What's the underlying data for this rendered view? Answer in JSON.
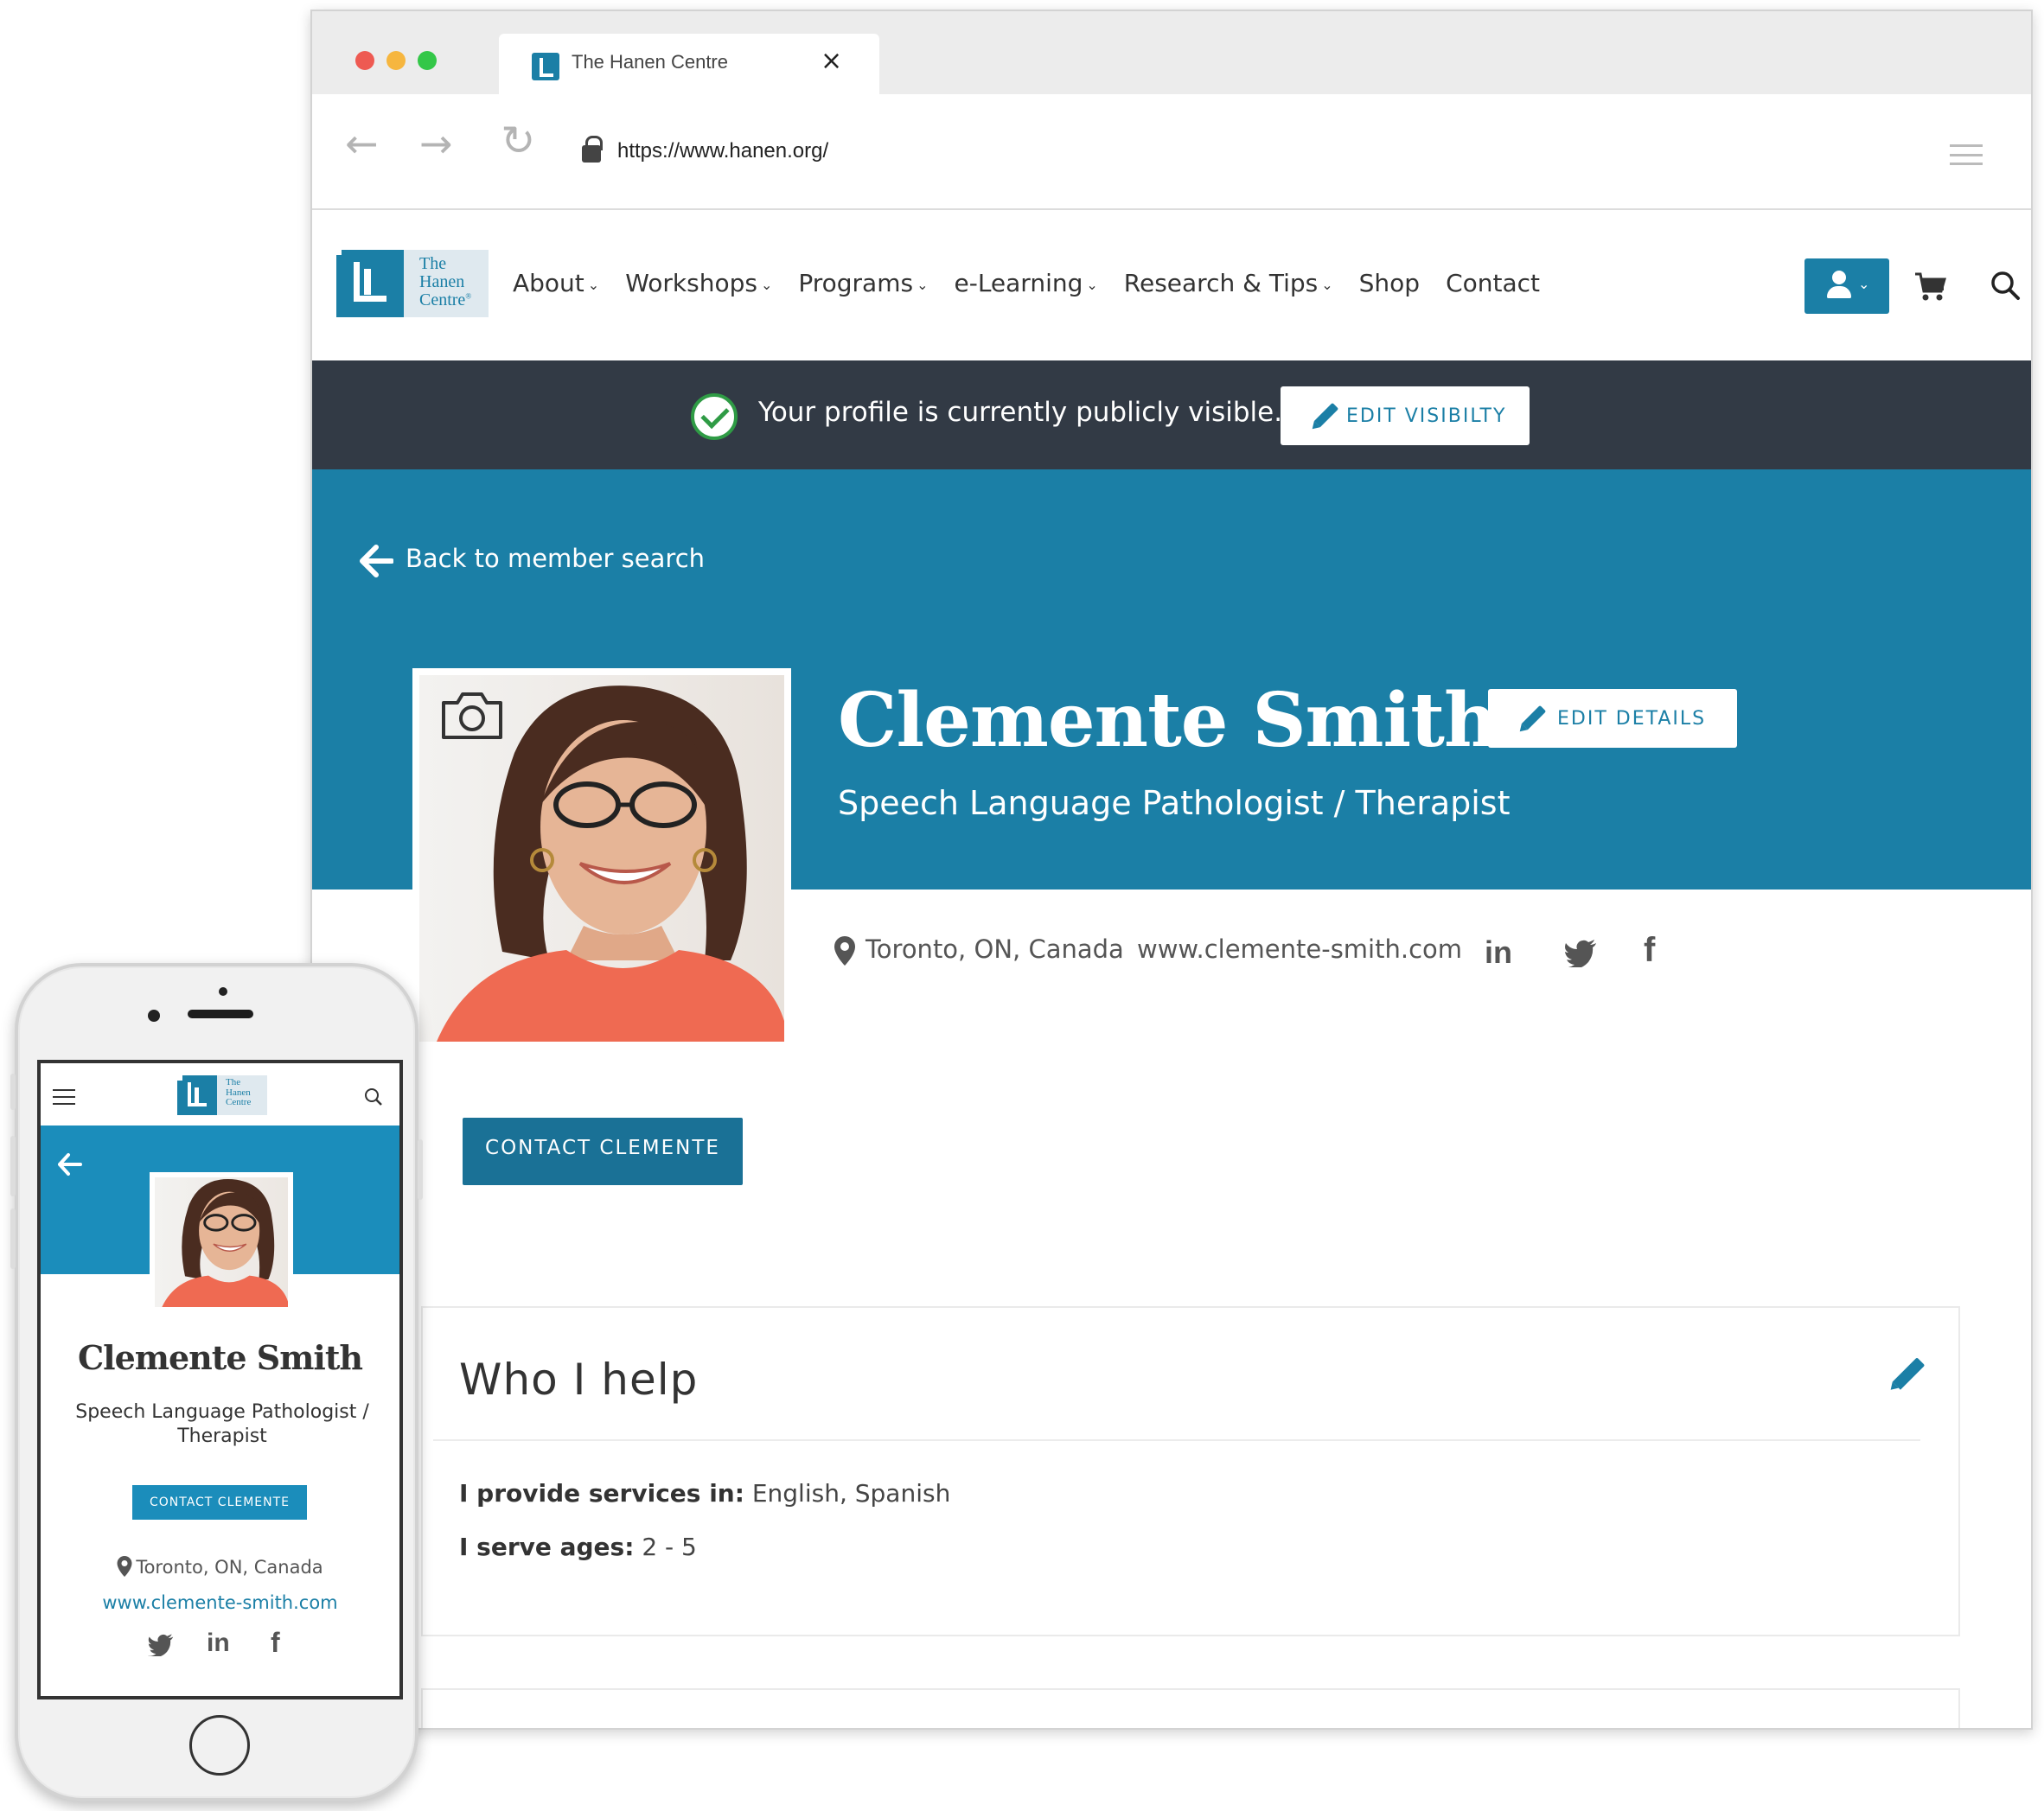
{
  "browser": {
    "tab_title": "The Hanen Centre",
    "tab_close_glyph": "×",
    "url": "https://www.hanen.org/",
    "back_glyph": "←",
    "forward_glyph": "→",
    "reload_glyph": "↻",
    "traffic_lights": [
      "#ee5a52",
      "#f6b63f",
      "#33c748"
    ]
  },
  "site": {
    "logo_text": [
      "The",
      "Hanen",
      "Centre"
    ],
    "logo_reg": "®",
    "nav": [
      {
        "label": "About",
        "caret": "⌄"
      },
      {
        "label": "Workshops",
        "caret": "⌄"
      },
      {
        "label": "Programs",
        "caret": "⌄"
      },
      {
        "label": "e-Learning",
        "caret": "⌄"
      },
      {
        "label": "Research & Tips",
        "caret": "⌄"
      },
      {
        "label": "Shop",
        "caret": ""
      },
      {
        "label": "Contact",
        "caret": ""
      }
    ],
    "account_caret": "⌄",
    "accent_color": "#1b7fa6",
    "banner_color": "#323a45"
  },
  "visibility": {
    "message": "Your profile is currently publicly visible.",
    "button_label": "EDIT VISIBILTY"
  },
  "profile": {
    "back_label": "Back to member search",
    "name": "Clemente Smith",
    "title": "Speech Language Pathologist / Therapist",
    "edit_label": "EDIT DETAILS",
    "location": "Toronto, ON, Canada",
    "website": "www.clemente-smith.com",
    "social": {
      "linkedin": "in",
      "facebook": "f"
    },
    "contact_label": "CONTACT CLEMENTE"
  },
  "who_i_help": {
    "heading": "Who I help",
    "languages_label": "I provide services in:",
    "languages_value": "English, Spanish",
    "ages_label": "I serve ages:",
    "ages_value": "2 - 5"
  },
  "mobile": {
    "name": "Clemente Smith",
    "title": "Speech Language Pathologist / Therapist",
    "contact_label": "CONTACT CLEMENTE",
    "location": "Toronto, ON, Canada",
    "website": "www.clemente-smith.com",
    "linkedin": "in",
    "facebook": "f"
  }
}
